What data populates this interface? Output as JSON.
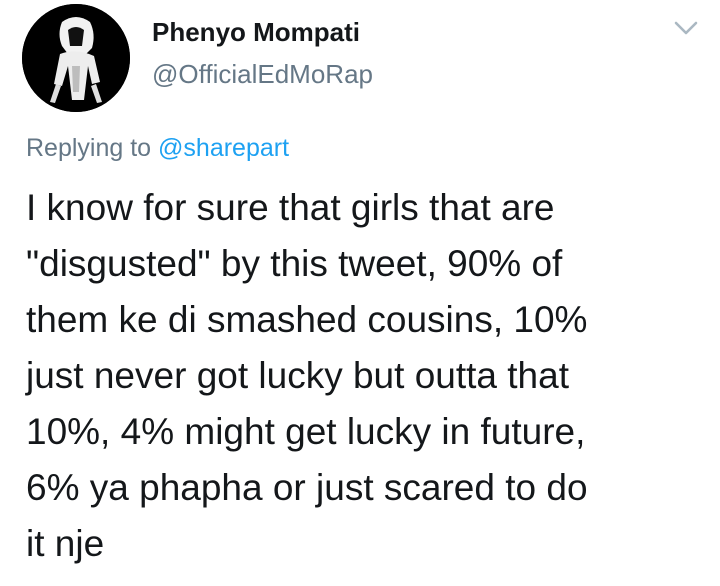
{
  "author": {
    "display_name": "Phenyo Mompati",
    "handle": "@OfficialEdMoRap",
    "avatar_icon": "hooded-figure-avatar"
  },
  "menu": {
    "icon": "chevron-down-icon"
  },
  "reply": {
    "prefix": "Replying to",
    "mention": "@sharepart"
  },
  "tweet": {
    "text": "I know for sure that girls that are\n\"disgusted\" by this tweet, 90% of\nthem ke di smashed cousins, 10%\njust never got lucky but outta that\n10%, 4% might get lucky in future,\n6% ya phapha or just scared to do\nit nje"
  },
  "colors": {
    "text_primary": "#14171a",
    "text_secondary": "#657786",
    "accent": "#1da1f2",
    "chevron": "#aab8c2"
  }
}
